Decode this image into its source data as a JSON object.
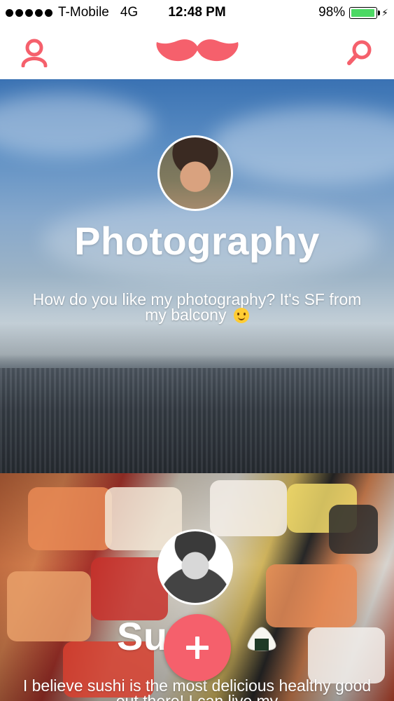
{
  "status_bar": {
    "carrier": "T-Mobile",
    "network": "4G",
    "time": "12:48 PM",
    "battery_percent": "98%",
    "battery_level": 0.98,
    "signal_bars": 5
  },
  "nav": {
    "left_icon": "profile-icon",
    "logo_icon": "mustache-logo-icon",
    "right_icon": "search-icon"
  },
  "feed": [
    {
      "title": "Photography",
      "description": "How do you like my photography? It's SF from my balcony",
      "emoji": "smiling-face-emoji"
    },
    {
      "title": "Sushi",
      "title_partial_visible": "Su",
      "description": "I believe sushi is the most delicious healthy good out there! I can live my",
      "emoji": "rice-ball-emoji"
    }
  ],
  "fab": {
    "icon": "plus-icon"
  },
  "colors": {
    "accent": "#f5606c",
    "battery": "#4cd964",
    "text_light": "#ffffff"
  }
}
